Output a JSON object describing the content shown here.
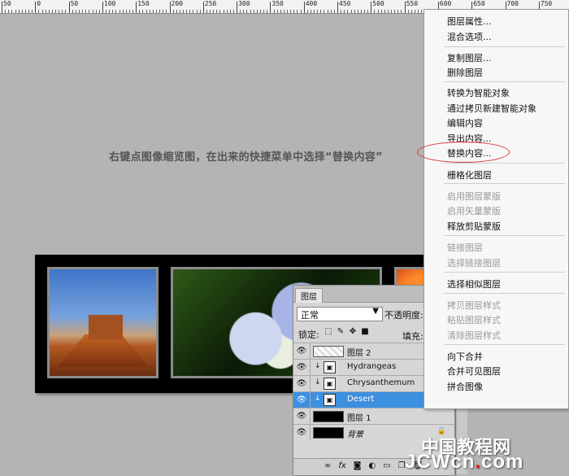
{
  "ruler": {
    "labels": [
      "50",
      "0",
      "50",
      "100",
      "150",
      "200",
      "250",
      "300",
      "350",
      "400",
      "450",
      "500",
      "550",
      "600",
      "650",
      "700",
      "750"
    ]
  },
  "instruction": "右键点图像缩览图，在出来的快捷菜单中选择“替换内容”",
  "layers_panel": {
    "tab": "图层",
    "blend_mode": "正常",
    "opacity_label": "不透明度:",
    "lock_label": "锁定:",
    "fill_label": "填充:",
    "layers": [
      {
        "name": "图层 2",
        "type": "checker",
        "selected": false
      },
      {
        "name": "Hydrangeas",
        "type": "smart",
        "selected": false
      },
      {
        "name": "Chrysanthemum",
        "type": "smart",
        "selected": false
      },
      {
        "name": "Desert",
        "type": "smart",
        "selected": true
      },
      {
        "name": "图层 1",
        "type": "black",
        "selected": false
      },
      {
        "name": "背景",
        "type": "black",
        "selected": false,
        "italic": true
      }
    ],
    "footer_icons": [
      "link-icon",
      "fx-icon",
      "mask-icon",
      "adjustment-icon",
      "folder-icon",
      "new-layer-icon",
      "trash-icon"
    ]
  },
  "context_menu": {
    "items": [
      {
        "label": "图层属性...",
        "disabled": false
      },
      {
        "label": "混合选项...",
        "disabled": false
      },
      {
        "label": "复制图层...",
        "disabled": false
      },
      {
        "label": "删除图层",
        "disabled": false
      },
      {
        "label": "转换为智能对象",
        "disabled": false
      },
      {
        "label": "通过拷贝新建智能对象",
        "disabled": false
      },
      {
        "label": "编辑内容",
        "disabled": false
      },
      {
        "label": "导出内容...",
        "disabled": false
      },
      {
        "label": "替换内容...",
        "disabled": false
      },
      {
        "label": "栅格化图层",
        "disabled": false
      },
      {
        "label": "启用图层蒙版",
        "disabled": true
      },
      {
        "label": "启用矢量蒙版",
        "disabled": true
      },
      {
        "label": "释放剪贴蒙版",
        "disabled": false
      },
      {
        "label": "链接图层",
        "disabled": true
      },
      {
        "label": "选择链接图层",
        "disabled": true
      },
      {
        "label": "选择相似图层",
        "disabled": false
      },
      {
        "label": "拷贝图层样式",
        "disabled": true
      },
      {
        "label": "粘贴图层样式",
        "disabled": true
      },
      {
        "label": "清除图层样式",
        "disabled": true
      },
      {
        "label": "向下合并",
        "disabled": false
      },
      {
        "label": "合并可见图层",
        "disabled": false
      },
      {
        "label": "拼合图像",
        "disabled": false
      }
    ],
    "highlight_color": "#d8362f"
  },
  "watermark": {
    "line1": "中国教程网",
    "line2a": "JCW",
    "line2b": "cn",
    "line2dot": ".",
    "line2c": "com"
  },
  "colors": {
    "selection": "#3d8fdf",
    "canvas_bg": "#b4b4b4"
  }
}
